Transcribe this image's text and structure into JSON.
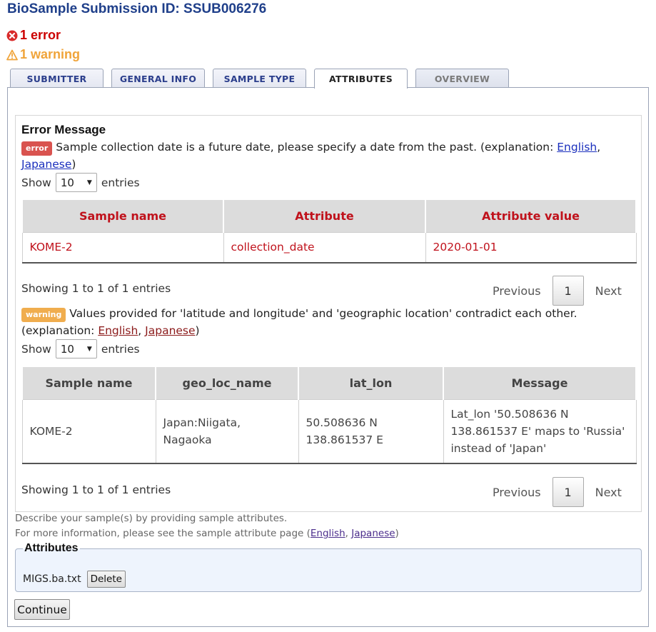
{
  "title": "BioSample Submission ID: SSUB006276",
  "status": {
    "errors": "1 error",
    "warnings": "1 warning",
    "colors": {
      "error": "#cc0000",
      "warning": "#f0a43a"
    }
  },
  "tabs": [
    {
      "label": "SUBMITTER",
      "state": "normal"
    },
    {
      "label": "GENERAL INFO",
      "state": "normal"
    },
    {
      "label": "SAMPLE TYPE",
      "state": "normal"
    },
    {
      "label": "ATTRIBUTES",
      "state": "active"
    },
    {
      "label": "OVERVIEW",
      "state": "disabled"
    }
  ],
  "messages": {
    "heading": "Error Message",
    "error": {
      "badge": "error",
      "text": "Sample collection date is a future date, please specify a date from the past. (explanation:",
      "link_en": "English",
      "sep": ",",
      "link_ja": "Japanese",
      "close": ")",
      "show_label": "Show",
      "show_value": "10",
      "entries_label": "entries",
      "headers": [
        "Sample name",
        "Attribute",
        "Attribute value"
      ],
      "rows": [
        [
          "KOME-2",
          "collection_date",
          "2020-01-01"
        ]
      ],
      "showing": "Showing 1 to 1 of 1 entries",
      "prev": "Previous",
      "page": "1",
      "next": "Next"
    },
    "warning": {
      "badge": "warning",
      "text": "Values provided for 'latitude and longitude' and 'geographic location' contradict each other.",
      "expl_prefix": "(explanation:",
      "link_en": "English",
      "sep": ",",
      "link_ja": "Japanese",
      "close": ")",
      "show_label": "Show",
      "show_value": "10",
      "entries_label": "entries",
      "headers": [
        "Sample name",
        "geo_loc_name",
        "lat_lon",
        "Message"
      ],
      "rows": [
        [
          "KOME-2",
          "Japan:Niigata, Nagaoka",
          "50.508636 N 138.861537 E",
          "Lat_lon '50.508636 N 138.861537 E' maps to 'Russia' instead of 'Japan'"
        ]
      ],
      "showing": "Showing 1 to 1 of 1 entries",
      "prev": "Previous",
      "page": "1",
      "next": "Next"
    }
  },
  "help": {
    "line1": "Describe your sample(s) by providing sample attributes.",
    "line2_prefix": "For more information, please see the sample attribute page (",
    "link_en": "English",
    "sep": ",",
    "link_ja": "Japanese",
    "close": ")"
  },
  "attributes": {
    "legend": "Attributes",
    "file_name": "MIGS.ba.txt",
    "delete_label": "Delete"
  },
  "continue_label": "Continue"
}
